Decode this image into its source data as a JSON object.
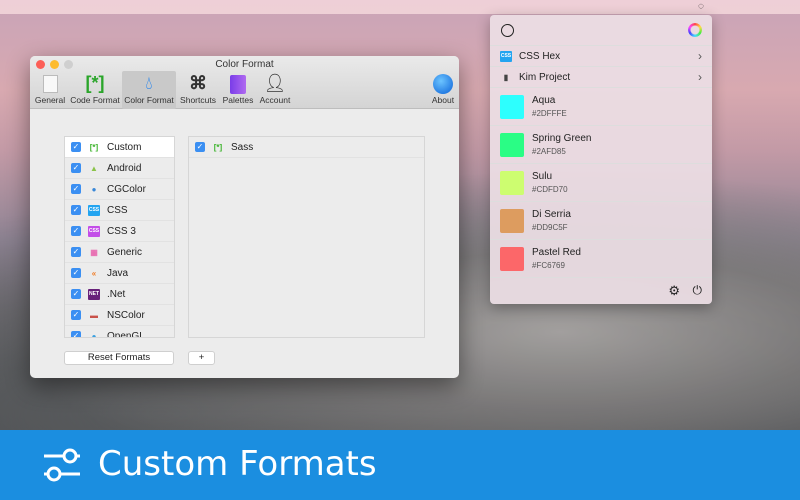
{
  "menubar": {
    "apple": "",
    "tray_icon": "clock-icon"
  },
  "window": {
    "title": "Color Format",
    "toolbar": [
      {
        "label": "General",
        "icon": "switch-icon"
      },
      {
        "label": "Code Format",
        "icon": "[*]"
      },
      {
        "label": "Color Format",
        "icon": "drop-icon",
        "selected": true
      },
      {
        "label": "Shortcuts",
        "icon": "⌘"
      },
      {
        "label": "Palettes",
        "icon": "palette-icon"
      },
      {
        "label": "Account",
        "icon": "person-icon"
      },
      {
        "label": "About",
        "icon": "globe-icon"
      }
    ],
    "formats": [
      {
        "label": "Custom",
        "glyph": "[*]",
        "color": "#3bb32a",
        "selected": true
      },
      {
        "label": "Android",
        "glyph": "▲",
        "color": "#8bc34a"
      },
      {
        "label": "CGColor",
        "glyph": "●",
        "color": "#3a88d8"
      },
      {
        "label": "CSS",
        "glyph": "CSS",
        "color": "#23a4f0"
      },
      {
        "label": "CSS 3",
        "glyph": "CSS",
        "color": "#c34ee8"
      },
      {
        "label": "Generic",
        "glyph": "▦",
        "color": "#e86bb0"
      },
      {
        "label": "Java",
        "glyph": "«",
        "color": "#f07a22"
      },
      {
        "label": ".Net",
        "glyph": "NET",
        "color": "#68217a"
      },
      {
        "label": "NSColor",
        "glyph": "▬",
        "color": "#c9524a"
      },
      {
        "label": "OpenGL",
        "glyph": "●",
        "color": "#3aa0e0"
      }
    ],
    "custom_formats": [
      {
        "label": "Sass",
        "glyph": "[*]"
      }
    ],
    "reset_label": "Reset Formats",
    "add_label": "+"
  },
  "popover": {
    "format": {
      "label": "CSS Hex",
      "glyph": "CSS"
    },
    "palette": {
      "label": "Kim Project"
    },
    "colors": [
      {
        "name": "Aqua",
        "hex": "#2DFFFE"
      },
      {
        "name": "Spring Green",
        "hex": "#2AFD85"
      },
      {
        "name": "Sulu",
        "hex": "#CDFD70"
      },
      {
        "name": "Di Serria",
        "hex": "#DD9C5F"
      },
      {
        "name": "Pastel Red",
        "hex": "#FC6769"
      }
    ]
  },
  "banner": {
    "title": "Custom Formats"
  }
}
